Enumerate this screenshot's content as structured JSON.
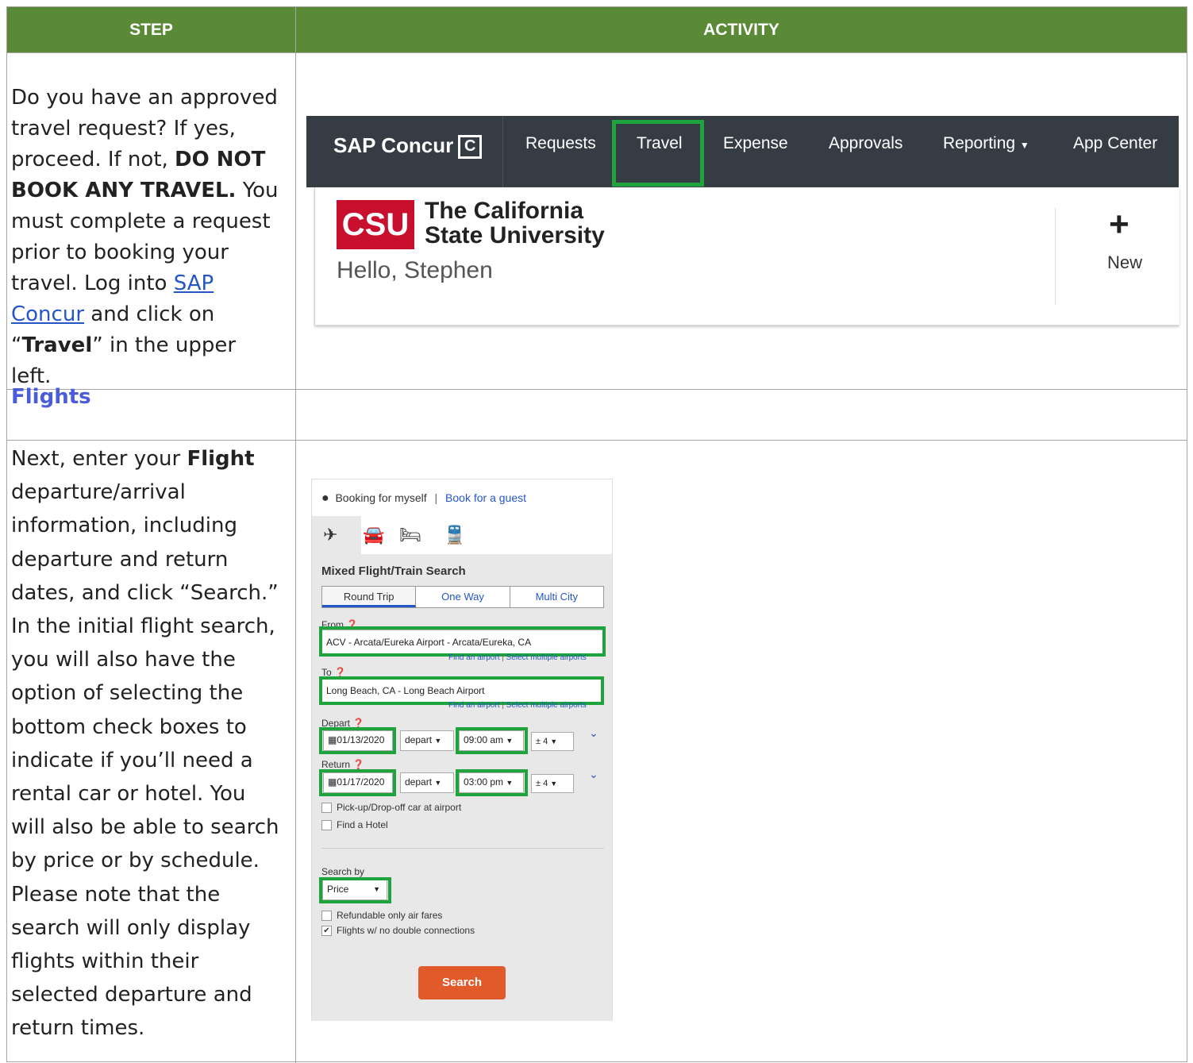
{
  "table": {
    "header_step": "STEP",
    "header_activity": "ACTIVITY"
  },
  "row1": {
    "text_1": "Do you have an approved travel request?  If yes, proceed.  If not, ",
    "bold_1": "DO NOT BOOK ANY TRAVEL.",
    "text_2": "  You must complete a request prior to booking your travel. Log into ",
    "link": "SAP Concur",
    "text_3": " and click on “",
    "bold_2": "Travel",
    "text_4": "” in the upper left."
  },
  "section": {
    "flights": "Flights"
  },
  "row2": {
    "text_1": "Next, enter your ",
    "bold_1": "Flight",
    "text_2": " departure/arrival information, including departure and return dates, and click “Search.” In the initial flight search, you will also have the option of selecting the bottom check boxes to indicate if you’ll need a rental car or hotel. You will also be able to search by price or by schedule. Please note that the search will only display flights within their selected departure and return times."
  },
  "concur": {
    "brand": "SAP Concur",
    "nav": [
      "Requests",
      "Travel",
      "Expense",
      "Approvals",
      "Reporting",
      "App Center"
    ],
    "org_logo": "CSU",
    "org_name_1": "The California",
    "org_name_2": "State University",
    "greeting": "Hello, Stephen",
    "new_label": "New",
    "highlight_color": "#1fa33c"
  },
  "flight": {
    "booking_self": "Booking for myself",
    "separator": "|",
    "booking_guest": "Book for a guest",
    "title": "Mixed Flight/Train Search",
    "tabs": [
      "Round Trip",
      "One Way",
      "Multi City"
    ],
    "from_label": "From",
    "from_value": "ACV - Arcata/Eureka Airport - Arcata/Eureka, CA",
    "find_airport": "Find an airport",
    "link_sep": "|",
    "select_multiple": "Select multiple airports",
    "to_label": "To",
    "to_value": "Long Beach, CA - Long Beach Airport",
    "depart_label": "Depart",
    "depart_date": "01/13/2020",
    "depart_mode": "depart",
    "depart_time": "09:00 am",
    "depart_window": "± 4",
    "return_label": "Return",
    "return_date": "01/17/2020",
    "return_mode": "depart",
    "return_time": "03:00 pm",
    "return_window": "± 4",
    "car_option": "Pick-up/Drop-off car at airport",
    "hotel_option": "Find a Hotel",
    "search_by_label": "Search by",
    "search_by_value": "Price",
    "refundable": "Refundable only air fares",
    "no_double": "Flights w/ no double connections",
    "search_button": "Search"
  }
}
